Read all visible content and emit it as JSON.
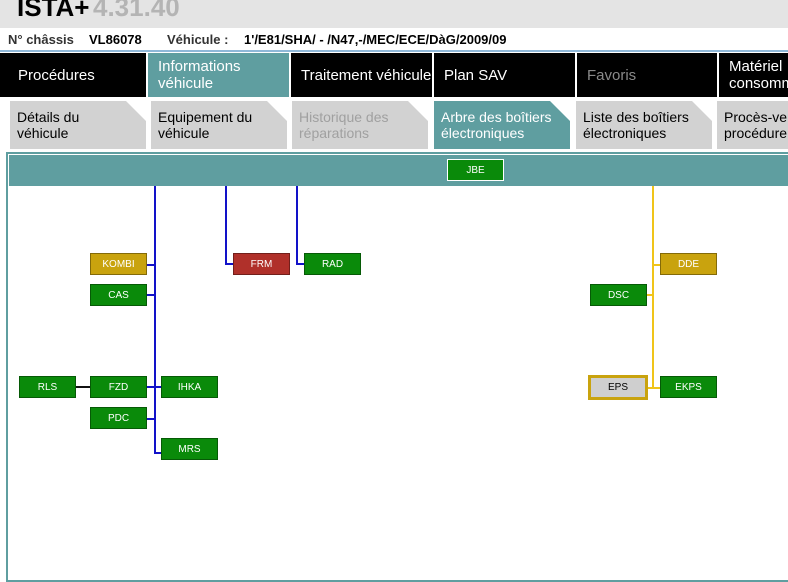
{
  "app": {
    "name": "ISTA+",
    "version": "4.31.40"
  },
  "vehicle": {
    "chassis_label": "N° châssis",
    "chassis_value": "VL86078",
    "vehicle_label": "Véhicule :",
    "vehicle_value": "1'/E81/SHA/ - /N47,-/MEC/ECE/DàG/2009/09"
  },
  "main_tabs": [
    {
      "label": "Procédures",
      "state": "normal"
    },
    {
      "label": "Informations\nvéhicule",
      "state": "active"
    },
    {
      "label": "Traitement véhicule",
      "state": "normal"
    },
    {
      "label": "Plan SAV",
      "state": "normal"
    },
    {
      "label": "Favoris",
      "state": "disabled"
    },
    {
      "label": "Matériel\nconsomm",
      "state": "normal"
    }
  ],
  "sub_tabs": [
    {
      "label": "Détails du\nvéhicule",
      "state": "normal"
    },
    {
      "label": "Equipement du\nvéhicule",
      "state": "normal"
    },
    {
      "label": "Historique des\nréparations",
      "state": "disabled"
    },
    {
      "label": "Arbre des boîtiers\nélectroniques",
      "state": "active"
    },
    {
      "label": "Liste des boîtiers\nélectroniques",
      "state": "normal"
    },
    {
      "label": "Procès-ve\nprocédure",
      "state": "normal"
    }
  ],
  "ecus": {
    "jbe": "JBE",
    "kombi": "KOMBI",
    "cas": "CAS",
    "frm": "FRM",
    "rad": "RAD",
    "dde": "DDE",
    "dsc": "DSC",
    "rls": "RLS",
    "fzd": "FZD",
    "ihka": "IHKA",
    "pdc": "PDC",
    "mrs": "MRS",
    "eps": "EPS",
    "ekps": "EKPS"
  },
  "colors": {
    "teal_accent": "#5f9ea0",
    "ecu_ok": "#0a8a0a",
    "ecu_warning": "#c9a30e",
    "ecu_fault": "#b0302a",
    "bus_blue": "#1212c8",
    "bus_yellow": "#f0c419"
  }
}
